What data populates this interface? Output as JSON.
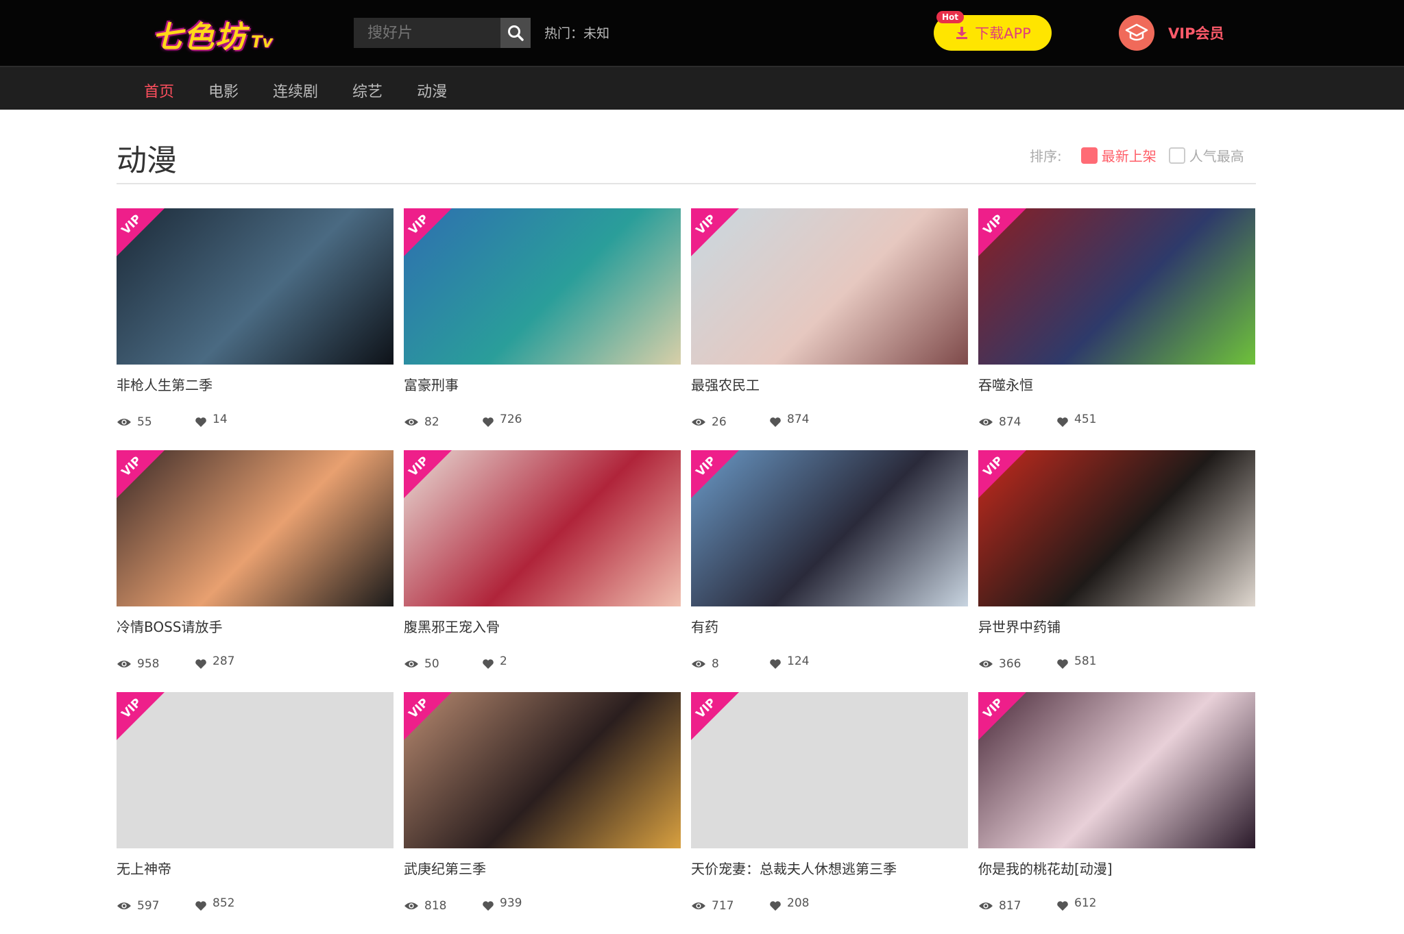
{
  "header": {
    "logo_main": "七色坊",
    "logo_tv": "Tv",
    "search_placeholder": "搜好片",
    "hot_label": "热门：未知",
    "download_label": "下载APP",
    "hot_badge": "Hot",
    "vip_label": "VIP会员"
  },
  "nav": {
    "items": [
      "首页",
      "电影",
      "连续剧",
      "综艺",
      "动漫"
    ],
    "active_index": 0
  },
  "section": {
    "title": "动漫",
    "sort_label": "排序:",
    "sort_options": [
      "最新上架",
      "人气最高"
    ],
    "sort_selected": 0
  },
  "vip_tag": "VIP",
  "cards": [
    {
      "title": "非枪人生第二季",
      "views": "55",
      "likes": "14",
      "poster": [
        "#1c2a38",
        "#4a6a82",
        "#0e1218"
      ]
    },
    {
      "title": "富豪刑事",
      "views": "82",
      "likes": "726",
      "poster": [
        "#2e6fb0",
        "#2a9e9a",
        "#d8cfa8"
      ]
    },
    {
      "title": "最强农民工",
      "views": "26",
      "likes": "874",
      "poster": [
        "#c9d8e0",
        "#e6c8c0",
        "#7e4a4a"
      ]
    },
    {
      "title": "吞噬永恒",
      "views": "874",
      "likes": "451",
      "poster": [
        "#8a1f24",
        "#2e3a6a",
        "#6fc23a"
      ]
    },
    {
      "title": "冷情BOSS请放手",
      "views": "958",
      "likes": "287",
      "poster": [
        "#3a2a28",
        "#e8a070",
        "#1a1a1a"
      ]
    },
    {
      "title": "腹黑邪王宠入骨",
      "views": "50",
      "likes": "2",
      "poster": [
        "#e8dcd6",
        "#b0243a",
        "#f0c0b0"
      ]
    },
    {
      "title": "有药",
      "views": "8",
      "likes": "124",
      "poster": [
        "#6a9ac8",
        "#2a2a3a",
        "#c8d4e0"
      ]
    },
    {
      "title": "异世界中药铺",
      "views": "366",
      "likes": "581",
      "poster": [
        "#c82a1e",
        "#1e1a18",
        "#e0d8d0"
      ]
    },
    {
      "title": "无上神帝",
      "views": "597",
      "likes": "852",
      "poster": [
        "#dcdcdc",
        "#dcdcdc",
        "#dcdcdc"
      ]
    },
    {
      "title": "武庚纪第三季",
      "views": "818",
      "likes": "939",
      "poster": [
        "#b88a70",
        "#2a1e1e",
        "#d8a040"
      ]
    },
    {
      "title": "天价宠妻：总裁夫人休想逃第三季",
      "views": "717",
      "likes": "208",
      "poster": [
        "#dcdcdc",
        "#dcdcdc",
        "#dcdcdc"
      ]
    },
    {
      "title": "你是我的桃花劫[动漫]",
      "views": "817",
      "likes": "612",
      "poster": [
        "#4a2a3a",
        "#e8d0d8",
        "#2a1a2a"
      ]
    }
  ]
}
